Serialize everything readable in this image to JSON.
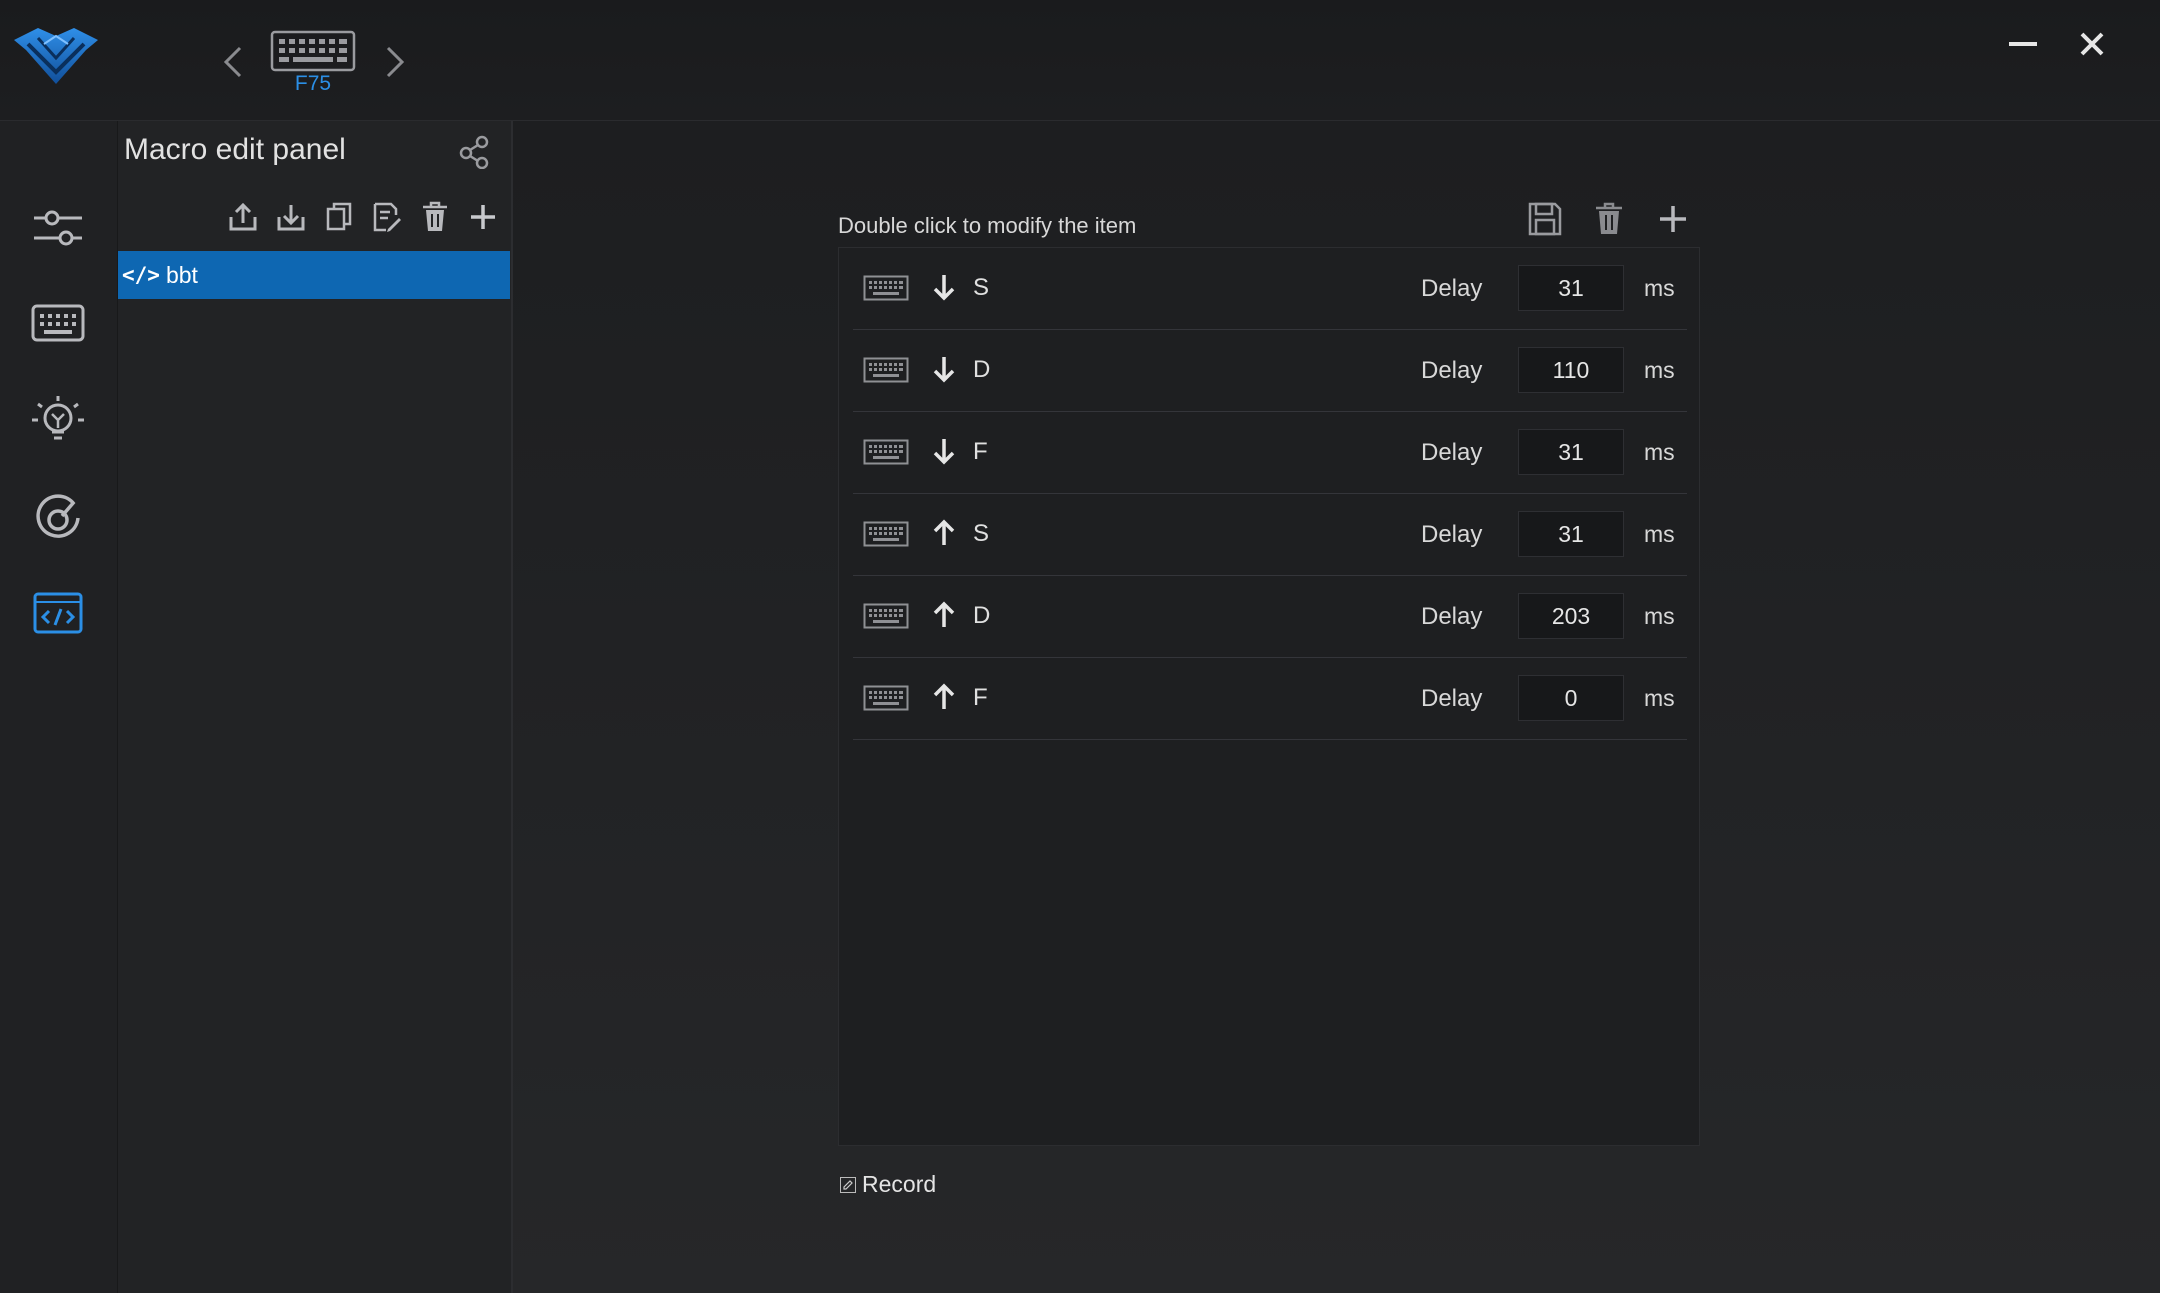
{
  "header": {
    "device_label": "F75",
    "accent_color": "#2b8fe6"
  },
  "sidebar": {
    "items": [
      {
        "icon": "sliders-icon",
        "active": false
      },
      {
        "icon": "keyboard-icon",
        "active": false
      },
      {
        "icon": "lighting-icon",
        "active": false
      },
      {
        "icon": "performance-icon",
        "active": false
      },
      {
        "icon": "macro-icon",
        "active": true
      }
    ]
  },
  "macro_panel": {
    "title": "Macro edit panel",
    "toolbar": [
      "export-icon",
      "import-icon",
      "copy-icon",
      "rename-icon",
      "delete-icon",
      "add-icon"
    ],
    "items": [
      {
        "tag": "</>",
        "name": "bbt",
        "selected": true
      }
    ],
    "selected_color": "#0e67b2"
  },
  "editor": {
    "hint": "Double click to modify the item",
    "tools": [
      "save-icon",
      "delete-icon",
      "add-icon"
    ],
    "delay_label": "Delay",
    "unit": "ms",
    "events": [
      {
        "direction": "down",
        "key": "S",
        "delay": "31"
      },
      {
        "direction": "down",
        "key": "D",
        "delay": "110"
      },
      {
        "direction": "down",
        "key": "F",
        "delay": "31"
      },
      {
        "direction": "up",
        "key": "S",
        "delay": "31"
      },
      {
        "direction": "up",
        "key": "D",
        "delay": "203"
      },
      {
        "direction": "up",
        "key": "F",
        "delay": "0"
      }
    ],
    "record_label": "Record"
  }
}
